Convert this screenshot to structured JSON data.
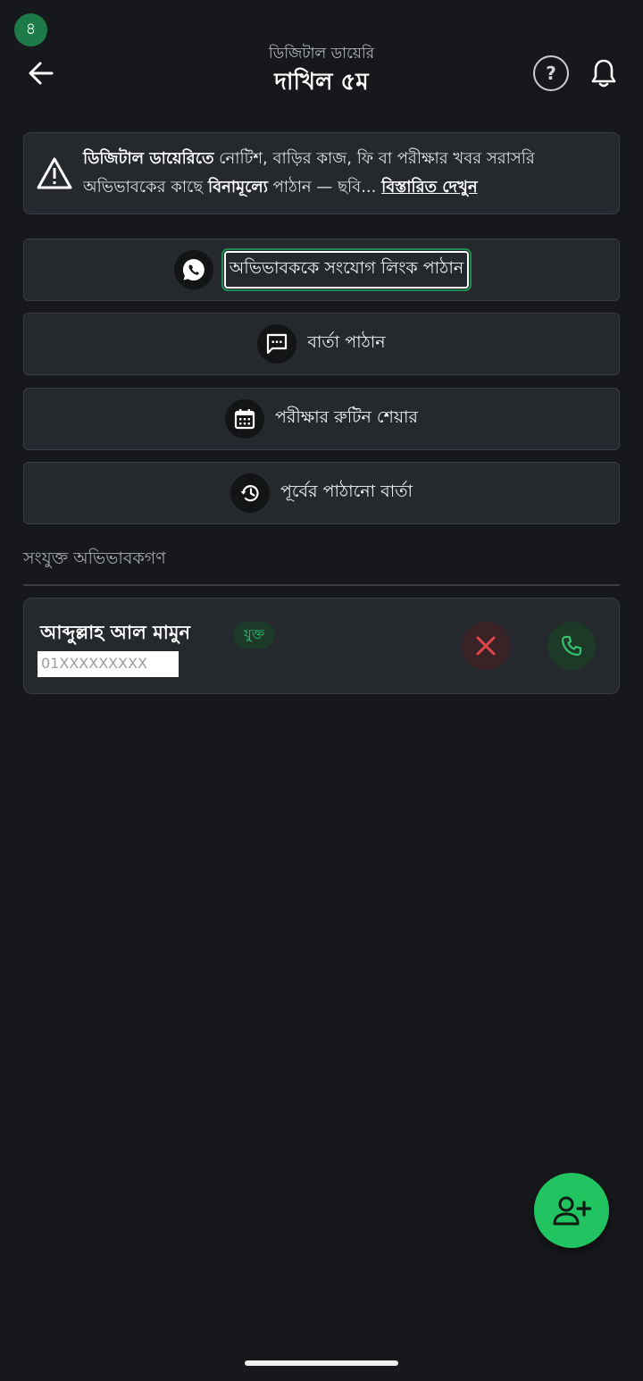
{
  "status_bar": {
    "badge": "৪"
  },
  "header": {
    "subtitle": "ডিজিটাল ডায়েরি",
    "title": "দাখিল ৫ম",
    "help_label": "?"
  },
  "notice": {
    "bold_lead": "ডিজিটাল ডায়েরিতে",
    "text_1": " নোটিশ, বাড়ির কাজ, ফি বা পরীক্ষার খবর সরাসরি অভিভাবকের কাছে ",
    "bold_free": "বিনামূল্যে",
    "text_2": " পাঠান — ছবি... ",
    "link": "বিস্তারিত দেখুন"
  },
  "actions": [
    {
      "label": "অভিভাবককে সংযোগ লিংক পাঠান",
      "icon": "whatsapp-icon"
    },
    {
      "label": "বার্তা পাঠান",
      "icon": "message-icon"
    },
    {
      "label": "পরীক্ষার রুটিন শেয়ার",
      "icon": "calendar-icon"
    },
    {
      "label": "পূর্বের পাঠানো বার্তা",
      "icon": "history-icon"
    }
  ],
  "guardians": {
    "section_title": "সংযুক্ত অভিভাবকগণ",
    "items": [
      {
        "name": "আব্দুল্লাহ আল মামুন",
        "status": "যুক্ত",
        "phone": "01XXXXXXXXX"
      }
    ]
  },
  "colors": {
    "background": "#16181b",
    "card": "#25282d",
    "accent_green": "#22c461",
    "danger_red": "#e0464a"
  }
}
